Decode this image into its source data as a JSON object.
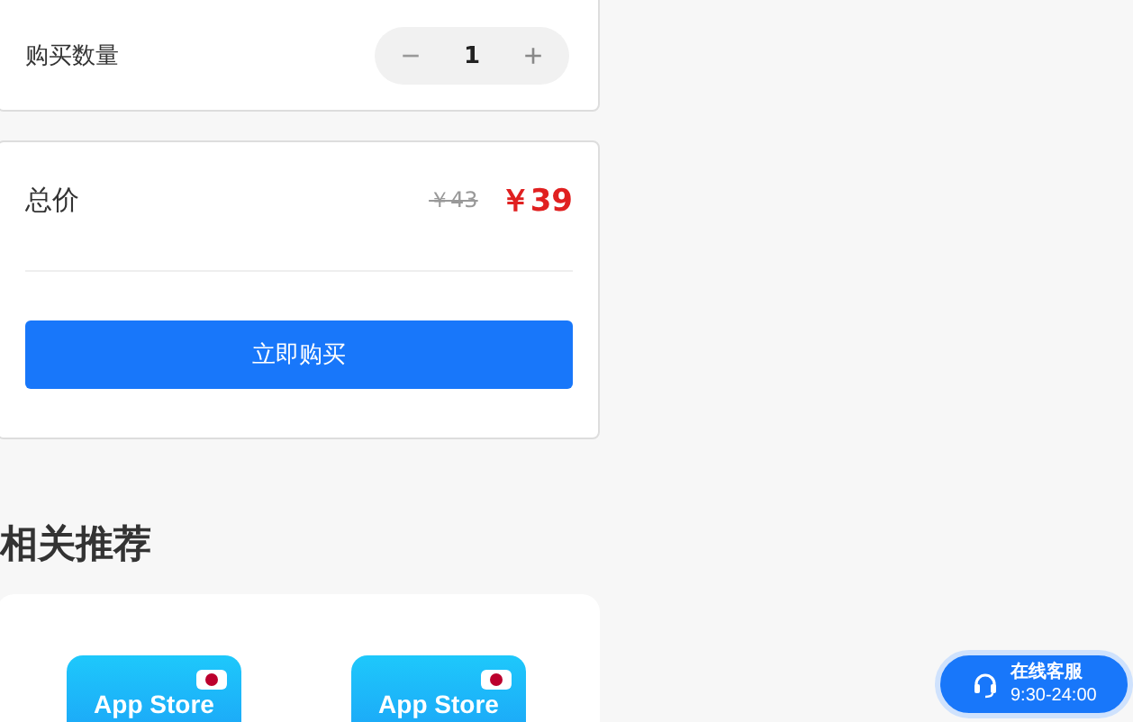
{
  "quantity": {
    "label": "购买数量",
    "decrement": "−",
    "value": "1",
    "increment": "+"
  },
  "total": {
    "label": "总价",
    "original_price": "￥43",
    "price": "￥39"
  },
  "buy_button": "立即购买",
  "recommend": {
    "title": "相关推荐",
    "items": [
      {
        "label": "App Store"
      },
      {
        "label": "App Store"
      }
    ]
  },
  "service": {
    "title": "在线客服",
    "hours": "9:30-24:00"
  }
}
